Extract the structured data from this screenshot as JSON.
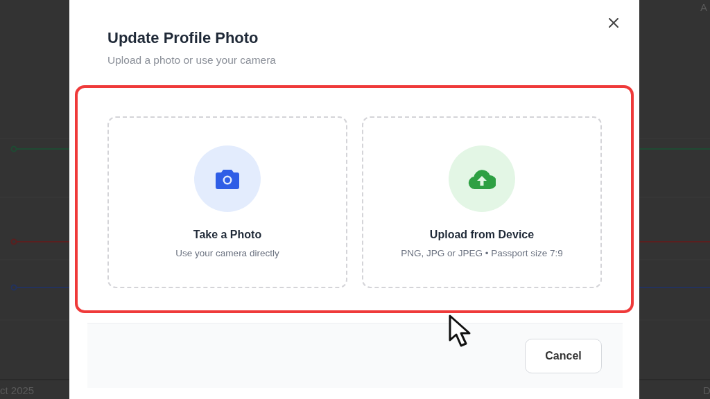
{
  "background": {
    "top_right_label": "A",
    "bottom_left_label": "ct 2025",
    "bottom_right_label": "D"
  },
  "dialog": {
    "title": "Update Profile Photo",
    "subtitle": "Upload a photo or use your camera",
    "highlighted": true,
    "options": [
      {
        "kind": "camera",
        "title": "Take a Photo",
        "description": "Use your camera directly"
      },
      {
        "kind": "upload",
        "title": "Upload from Device",
        "description": "PNG, JPG or JPEG • Passport size 7:9"
      }
    ],
    "buttons": [
      {
        "label": "Cancel"
      }
    ]
  }
}
